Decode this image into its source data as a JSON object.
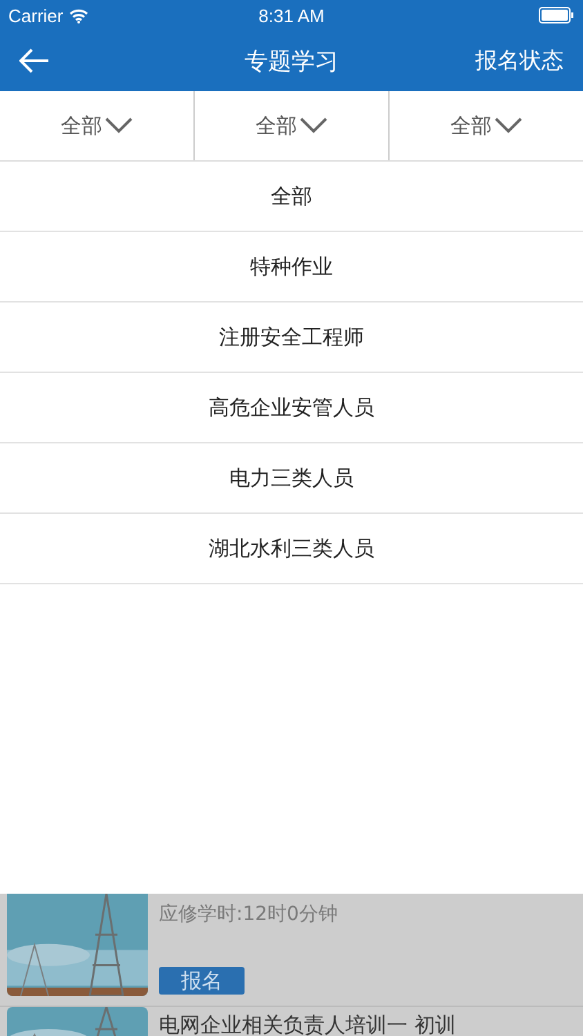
{
  "status_bar": {
    "carrier": "Carrier",
    "time": "8:31 AM"
  },
  "nav": {
    "title": "专题学习",
    "action": "报名状态"
  },
  "filters": [
    {
      "label": "全部"
    },
    {
      "label": "全部"
    },
    {
      "label": "全部"
    }
  ],
  "dropdown": {
    "options": [
      {
        "label": "全部"
      },
      {
        "label": "特种作业"
      },
      {
        "label": "注册安全工程师"
      },
      {
        "label": "高危企业安管人员"
      },
      {
        "label": "电力三类人员"
      },
      {
        "label": "湖北水利三类人员"
      }
    ]
  },
  "courses": [
    {
      "hours": "应修学时:12时0分钟",
      "button": "报名"
    },
    {
      "title": "电网企业相关负责人培训一 初训"
    }
  ]
}
